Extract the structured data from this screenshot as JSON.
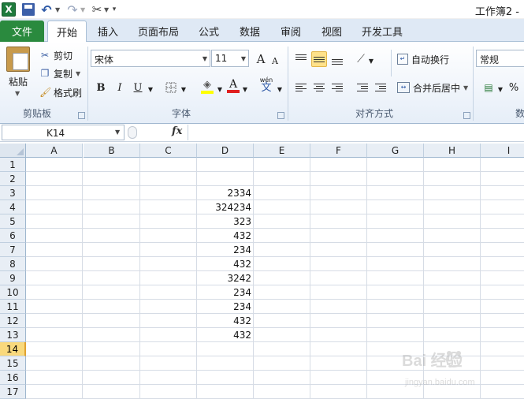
{
  "app": {
    "logo_letter": "X",
    "window_title": "工作簿2 -"
  },
  "ribbon_tabs": {
    "file": "文件",
    "items": [
      "开始",
      "插入",
      "页面布局",
      "公式",
      "数据",
      "审阅",
      "视图",
      "开发工具"
    ],
    "active_index": 0
  },
  "clipboard": {
    "paste": "粘贴",
    "cut": "剪切",
    "copy": "复制",
    "format_painter": "格式刷",
    "group_label": "剪贴板"
  },
  "font": {
    "name": "宋体",
    "size": "11",
    "grow_glyph": "A",
    "shrink_glyph": "A",
    "bold": "B",
    "italic": "I",
    "underline": "U",
    "font_color_glyph": "A",
    "phonetic_glyph": "wén",
    "phonetic_char": "文",
    "group_label": "字体"
  },
  "alignment": {
    "wrap_text": "自动换行",
    "merge_center": "合并后居中",
    "group_label": "对齐方式"
  },
  "number": {
    "format": "常规",
    "percent": "%",
    "group_label_partial": "数"
  },
  "formula_bar": {
    "name_box": "K14",
    "fx": "fx",
    "value": ""
  },
  "sheet": {
    "columns": [
      "A",
      "B",
      "C",
      "D",
      "E",
      "F",
      "G",
      "H",
      "I"
    ],
    "rows": [
      "1",
      "2",
      "3",
      "4",
      "5",
      "6",
      "7",
      "8",
      "9",
      "10",
      "11",
      "12",
      "13",
      "14",
      "15",
      "16",
      "17"
    ],
    "selected_row": "14",
    "column_d_values": [
      "",
      "",
      "2334",
      "324234",
      "323",
      "432",
      "234",
      "432",
      "3242",
      "234",
      "234",
      "432",
      "432",
      "",
      "",
      "",
      ""
    ]
  },
  "watermark": {
    "brand": "Bai 经验",
    "url": "jingyan.baidu.com"
  },
  "colors": {
    "file_tab": "#2a8a3e",
    "selected_row_header": "#f9d97c",
    "highlight_button": "#ffe28a",
    "font_color_bar": "#e02020",
    "fill_color_bar": "#ffff00"
  }
}
